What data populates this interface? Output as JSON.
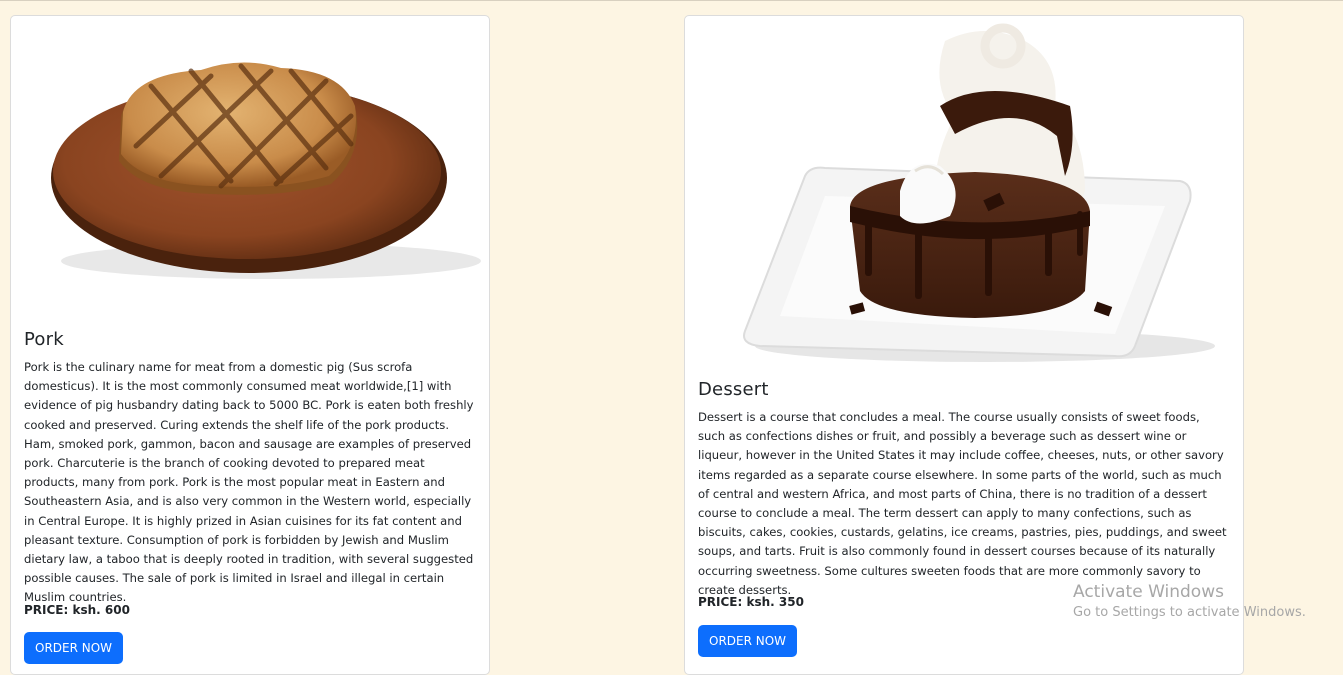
{
  "products": [
    {
      "title": "Pork",
      "description": "Pork is the culinary name for meat from a domestic pig (Sus scrofa domesticus). It is the most commonly consumed meat worldwide,[1] with evidence of pig husbandry dating back to 5000 BC. Pork is eaten both freshly cooked and preserved. Curing extends the shelf life of the pork products. Ham, smoked pork, gammon, bacon and sausage are examples of preserved pork. Charcuterie is the branch of cooking devoted to prepared meat products, many from pork. Pork is the most popular meat in Eastern and Southeastern Asia, and is also very common in the Western world, especially in Central Europe. It is highly prized in Asian cuisines for its fat content and pleasant texture. Consumption of pork is forbidden by Jewish and Muslim dietary law, a taboo that is deeply rooted in tradition, with several suggested possible causes. The sale of pork is limited in Israel and illegal in certain Muslim countries.",
      "price": "PRICE: ksh. 600",
      "button_label": "ORDER NOW"
    },
    {
      "title": "Dessert",
      "description": "Dessert is a course that concludes a meal. The course usually consists of sweet foods, such as confections dishes or fruit, and possibly a beverage such as dessert wine or liqueur, however in the United States it may include coffee, cheeses, nuts, or other savory items regarded as a separate course elsewhere. In some parts of the world, such as much of central and western Africa, and most parts of China, there is no tradition of a dessert course to conclude a meal. The term dessert can apply to many confections, such as biscuits, cakes, cookies, custards, gelatins, ice creams, pastries, pies, puddings, and sweet soups, and tarts. Fruit is also commonly found in dessert courses because of its naturally occurring sweetness. Some cultures sweeten foods that are more commonly savory to create desserts.",
      "price": "PRICE: ksh. 350",
      "button_label": "ORDER NOW"
    }
  ],
  "watermark": {
    "title": "Activate Windows",
    "subtitle": "Go to Settings to activate Windows."
  },
  "colors": {
    "page_background": "#fdf5e3",
    "button": "#0d6efd"
  }
}
